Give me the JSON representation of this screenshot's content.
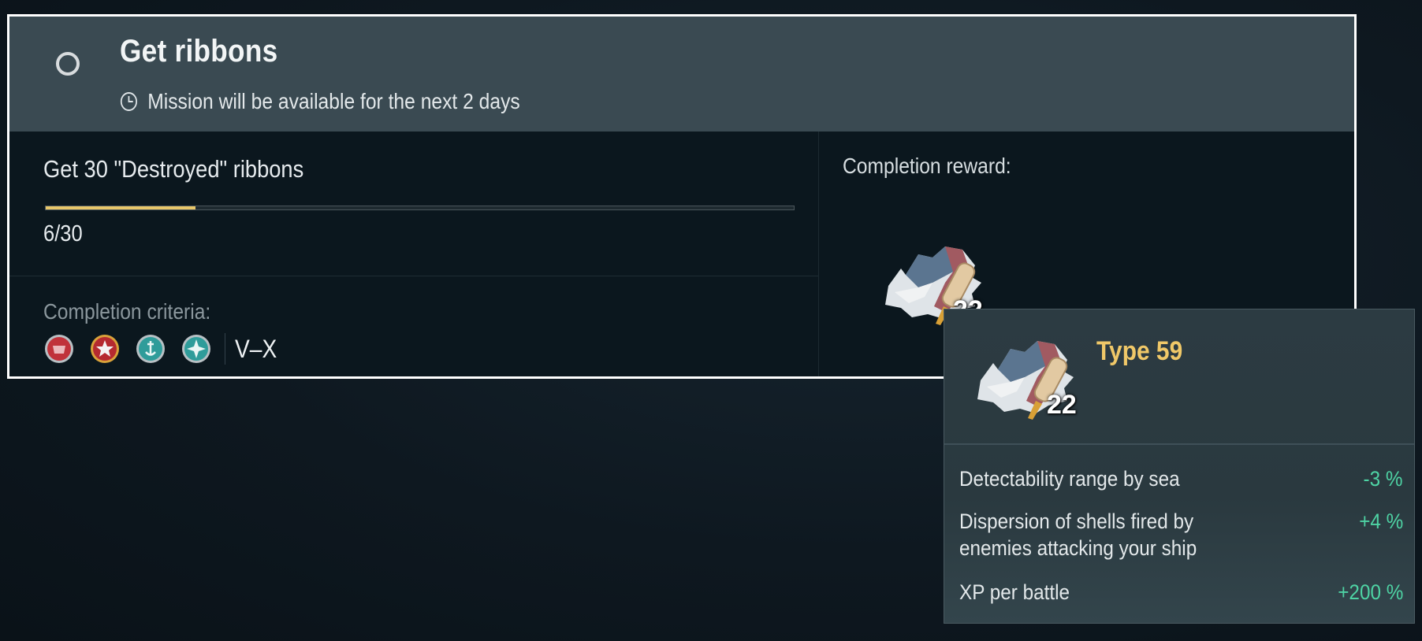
{
  "mission": {
    "title": "Get ribbons",
    "availability": "Mission will be available for the next 2 days",
    "objective": "Get 30 \"Destroyed\" ribbons",
    "progress": {
      "current": 6,
      "total": 30,
      "text": "6/30",
      "fraction": 0.2
    },
    "criteria_label": "Completion criteria:",
    "ship_classes": [
      {
        "icon": "destroyer-icon",
        "color": "#c0323a"
      },
      {
        "icon": "cruiser-icon",
        "color": "#c0323a"
      },
      {
        "icon": "battleship-icon",
        "color": "#2f9c9a"
      },
      {
        "icon": "aircraft-carrier-icon",
        "color": "#2f9c9a"
      }
    ],
    "tiers": "V–X",
    "reward_label": "Completion reward:",
    "reward": {
      "icon": "camouflage-icon",
      "count": "22"
    }
  },
  "tooltip": {
    "name": "Type 59",
    "count": "22",
    "stats": [
      {
        "name": "Detectability range by sea",
        "value": "-3 %"
      },
      {
        "name": "Dispersion of shells fired by enemies attacking your ship",
        "value": "+4 %"
      },
      {
        "name": "XP per battle",
        "value": "+200 %"
      }
    ]
  },
  "colors": {
    "accent": "#e8c76a",
    "bonus": "#4ed3a4",
    "tooltip_title": "#f0c868"
  }
}
